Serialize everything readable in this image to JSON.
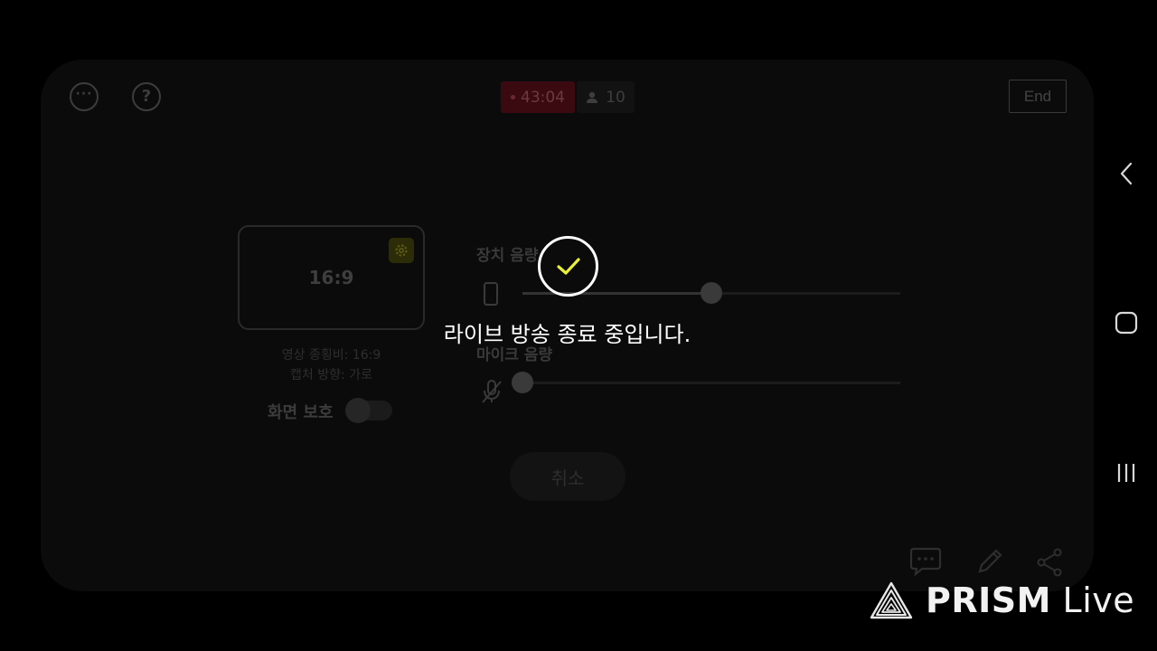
{
  "header": {
    "more_icon": "more-horizontal-icon",
    "help_icon": "help-question-icon",
    "live_timer": "43:04",
    "viewer_count": "10",
    "end_label": "End"
  },
  "preview": {
    "aspect_label": "16:9",
    "ratio_info": "영상 종횡비: 16:9",
    "capture_info": "캡처 방향: 가로",
    "screen_protect_label": "화면 보호"
  },
  "volume": {
    "device_label": "장치 음량",
    "mic_label": "마이크 음량",
    "device_level": 0.5,
    "mic_level": 0.0
  },
  "actions": {
    "cancel_label": "취소"
  },
  "overlay": {
    "message": "라이브 방송 종료 중입니다."
  },
  "watermark": {
    "brand": "PRISM",
    "suffix": "Live"
  },
  "colors": {
    "accent_yellow": "#e8f03a",
    "live_red": "#e0142d"
  }
}
